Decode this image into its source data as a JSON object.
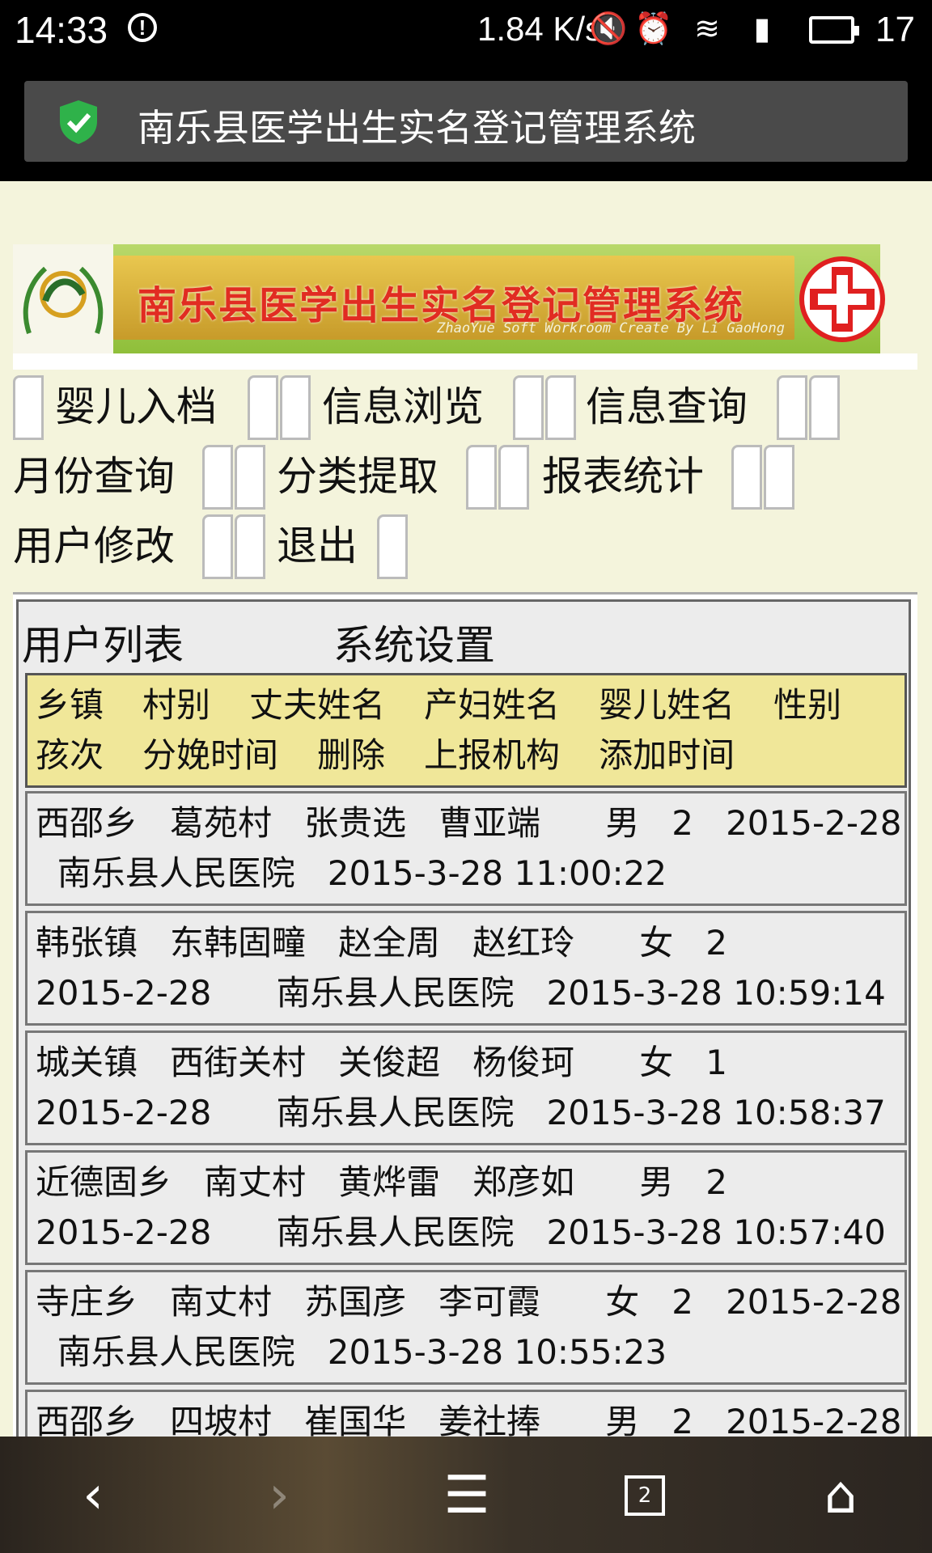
{
  "status_bar": {
    "time": "14:33",
    "speed": "1.84 K/s",
    "battery": "17"
  },
  "browser": {
    "title": "南乐县医学出生实名登记管理系统"
  },
  "banner": {
    "title": "南乐县医学出生实名登记管理系统",
    "subtitle": "ZhaoYue Soft Workroom Create By Li GaoHong"
  },
  "nav": {
    "items": [
      "婴儿入档",
      "信息浏览",
      "信息查询",
      "月份查询",
      "分类提取",
      "报表统计",
      "用户修改",
      "退出"
    ]
  },
  "panel": {
    "tabs": [
      "用户列表",
      "系统设置"
    ],
    "columns": [
      "乡镇",
      "村别",
      "丈夫姓名",
      "产妇姓名",
      "婴儿姓名",
      "性别",
      "孩次",
      "分娩时间",
      "删除",
      "上报机构",
      "添加时间"
    ],
    "rows": [
      {
        "line1": "西邵乡   葛苑村   张贵选   曹亚端      男   2   2015-2-28",
        "line2": "  南乐县人民医院   2015-3-28 11:00:22"
      },
      {
        "line1": "韩张镇   东韩固疃   赵全周   赵红玲      女   2",
        "line2": "2015-2-28      南乐县人民医院   2015-3-28 10:59:14"
      },
      {
        "line1": "城关镇   西街关村   关俊超   杨俊珂      女   1",
        "line2": "2015-2-28      南乐县人民医院   2015-3-28 10:58:37"
      },
      {
        "line1": "近德固乡   南丈村   黄烨雷   郑彦如      男   2",
        "line2": "2015-2-28      南乐县人民医院   2015-3-28 10:57:40"
      },
      {
        "line1": "寺庄乡   南丈村   苏国彦   李可霞      女   2   2015-2-28",
        "line2": "  南乐县人民医院   2015-3-28 10:55:23"
      },
      {
        "line1": "西邵乡   四坡村   崔国华   姜社捧      男   2   2015-2-28",
        "line2": ""
      }
    ]
  },
  "system_nav": {
    "tab_count": "2"
  }
}
